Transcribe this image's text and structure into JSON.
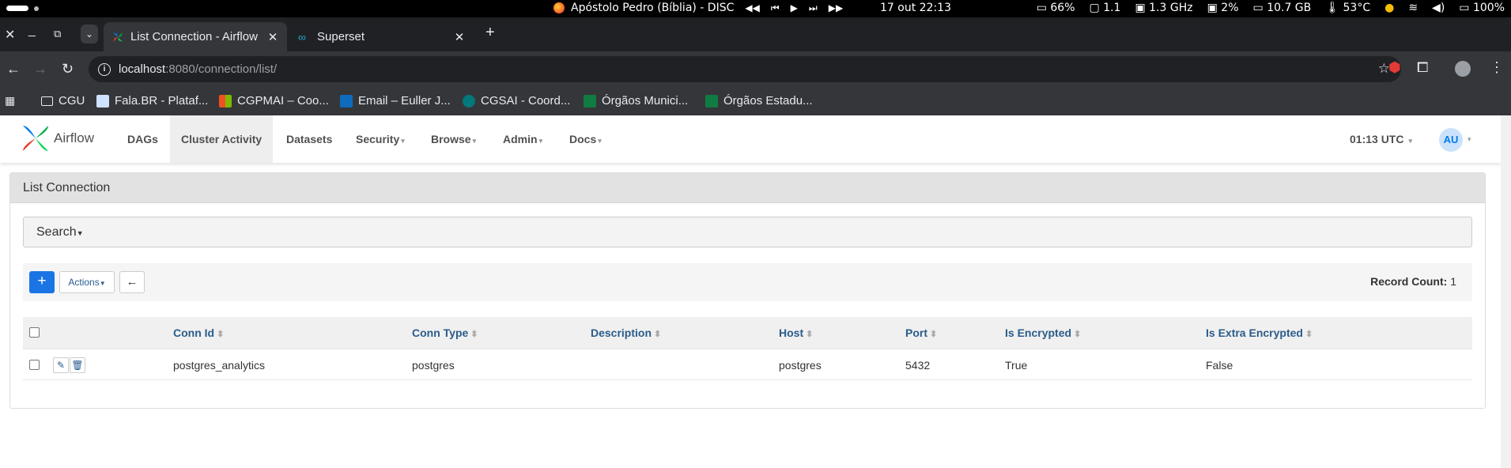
{
  "system_bar": {
    "media_title": "Apóstolo Pedro (Bíblia) - DISC",
    "clock": "17 out  22:13",
    "stats": [
      "66%",
      "1.1",
      "1.3 GHz",
      "2%",
      "10.7 GB",
      "53°C",
      "100%"
    ]
  },
  "browser": {
    "tabs": [
      {
        "label": "List Connection - Airflow",
        "active": true
      },
      {
        "label": "Superset",
        "active": false
      }
    ],
    "url_host": "localhost",
    "url_path": ":8080/connection/list/",
    "bookmarks": [
      "CGU",
      "Fala.BR - Plataf...",
      "CGPMAI – Coo...",
      "Email – Euller J...",
      "CGSAI - Coord...",
      "Órgãos Munici...",
      "Órgãos Estadu..."
    ]
  },
  "app": {
    "brand": "Airflow",
    "nav": [
      "DAGs",
      "Cluster Activity",
      "Datasets",
      "Security",
      "Browse",
      "Admin",
      "Docs"
    ],
    "time": "01:13 UTC",
    "user_initials": "AU",
    "accent": "#017cee"
  },
  "page": {
    "title": "List Connection",
    "search_label": "Search",
    "add_label": "+",
    "actions_label": "Actions",
    "record_count_label": "Record Count:",
    "record_count": "1"
  },
  "table": {
    "headers": [
      "Conn Id",
      "Conn Type",
      "Description",
      "Host",
      "Port",
      "Is Encrypted",
      "Is Extra Encrypted"
    ],
    "rows": [
      [
        "postgres_analytics",
        "postgres",
        "",
        "postgres",
        "5432",
        "True",
        "False"
      ]
    ]
  }
}
